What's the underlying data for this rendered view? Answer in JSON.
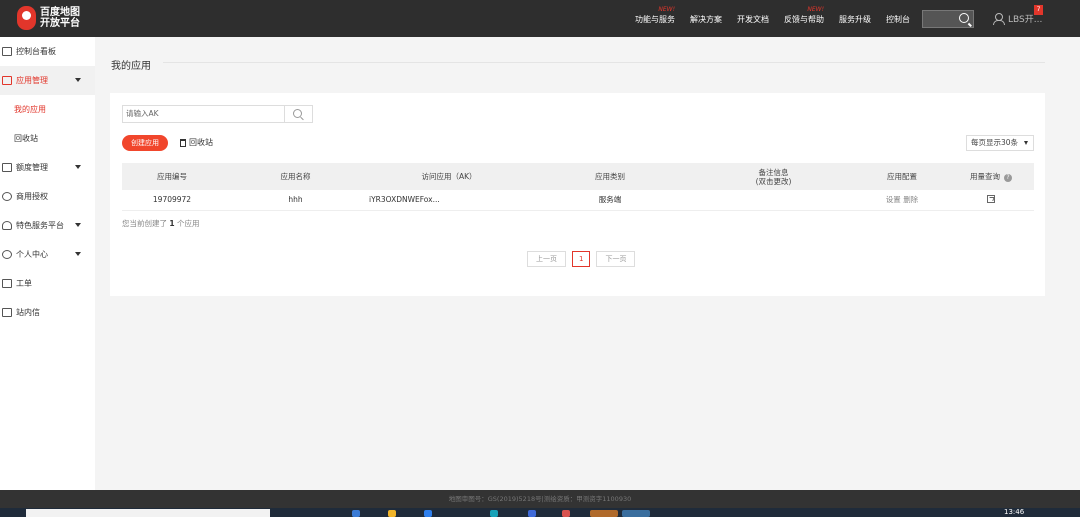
{
  "header": {
    "logo_line1": "百度地图",
    "logo_line2": "开放平台",
    "nav": [
      {
        "label": "功能与服务",
        "tag": "NEW!"
      },
      {
        "label": "解决方案",
        "tag": ""
      },
      {
        "label": "开发文档",
        "tag": ""
      },
      {
        "label": "反馈与帮助",
        "tag": "NEW!"
      },
      {
        "label": "服务升级",
        "tag": ""
      },
      {
        "label": "控制台",
        "tag": ""
      }
    ],
    "user_name": "LBS开...",
    "badge_count": "7"
  },
  "sidebar": {
    "items": [
      {
        "label": "控制台看板"
      },
      {
        "label": "应用管理"
      },
      {
        "label": "我的应用"
      },
      {
        "label": "回收站"
      },
      {
        "label": "额度管理"
      },
      {
        "label": "商用授权"
      },
      {
        "label": "特色服务平台"
      },
      {
        "label": "个人中心"
      },
      {
        "label": "工单"
      },
      {
        "label": "站内信"
      }
    ]
  },
  "main": {
    "title": "我的应用",
    "ak_placeholder": "请输入AK",
    "create_label": "创建应用",
    "recycle_label": "回收站",
    "per_page": "每页显示30条",
    "table": {
      "headers": [
        "应用编号",
        "应用名称",
        "访问应用（AK）",
        "应用类别",
        "备注信息",
        "(双击更改)",
        "应用配置",
        "用量查询"
      ],
      "rows": [
        {
          "id": "19709972",
          "name": "hhh",
          "ak": "iYR3OXDNWEFox...",
          "category": "服务端",
          "note": "",
          "config_set": "设置",
          "config_delete": "删除"
        }
      ]
    },
    "count_prefix": "您当前创建了",
    "count": "1",
    "count_suffix": "个应用",
    "pager": {
      "prev": "上一页",
      "current": "1",
      "next": "下一页"
    }
  },
  "footer": {
    "text": "地图审图号：GS(2019)5218号|测绘资质：甲测资字1100930"
  },
  "taskbar": {
    "clock": "13:46"
  }
}
